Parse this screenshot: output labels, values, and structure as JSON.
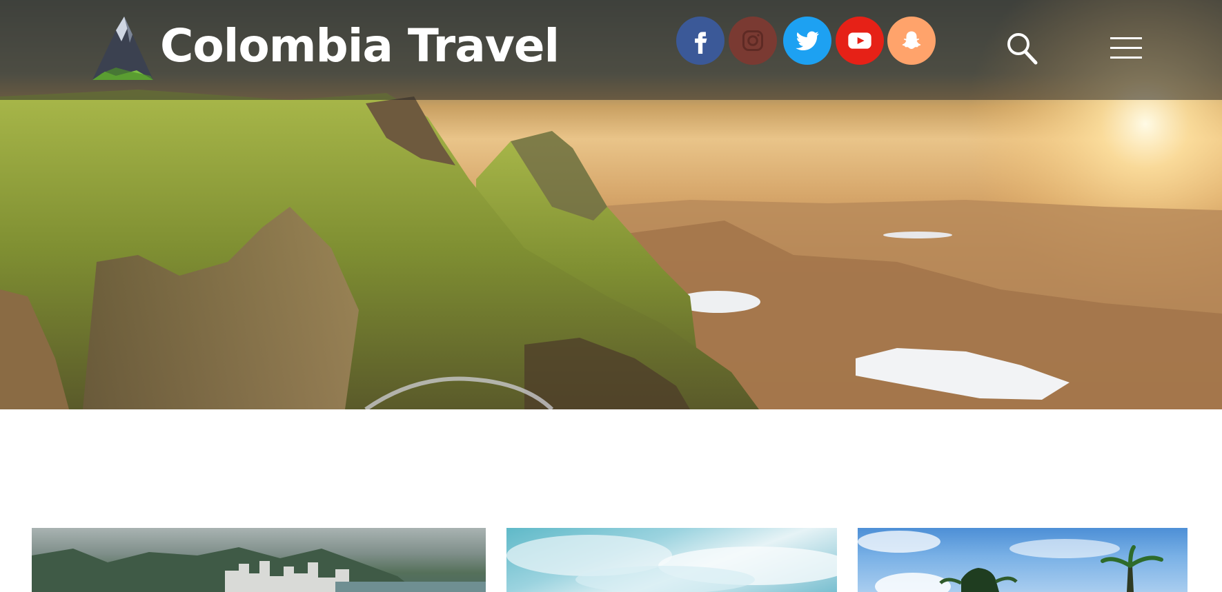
{
  "header": {
    "brand_title": "Colombia Travel"
  },
  "social": [
    {
      "name": "facebook",
      "icon": "facebook-icon",
      "color": "#3b5998"
    },
    {
      "name": "instagram",
      "icon": "instagram-icon",
      "color": "#7a3a32"
    },
    {
      "name": "twitter",
      "icon": "twitter-icon",
      "color": "#1da1f2"
    },
    {
      "name": "youtube",
      "icon": "youtube-icon",
      "color": "#e62117"
    },
    {
      "name": "snapchat",
      "icon": "snapchat-icon",
      "color": "#ffa36b"
    }
  ],
  "controls": {
    "search_icon": "search-icon",
    "menu_icon": "hamburger-menu-icon"
  },
  "hero": {
    "image": "mountain-landscape-sunset"
  },
  "cards": [
    {
      "image": "coastal-city-mountains"
    },
    {
      "image": "cloudy-sky-sea"
    },
    {
      "image": "palm-trees-blue-sky"
    }
  ]
}
